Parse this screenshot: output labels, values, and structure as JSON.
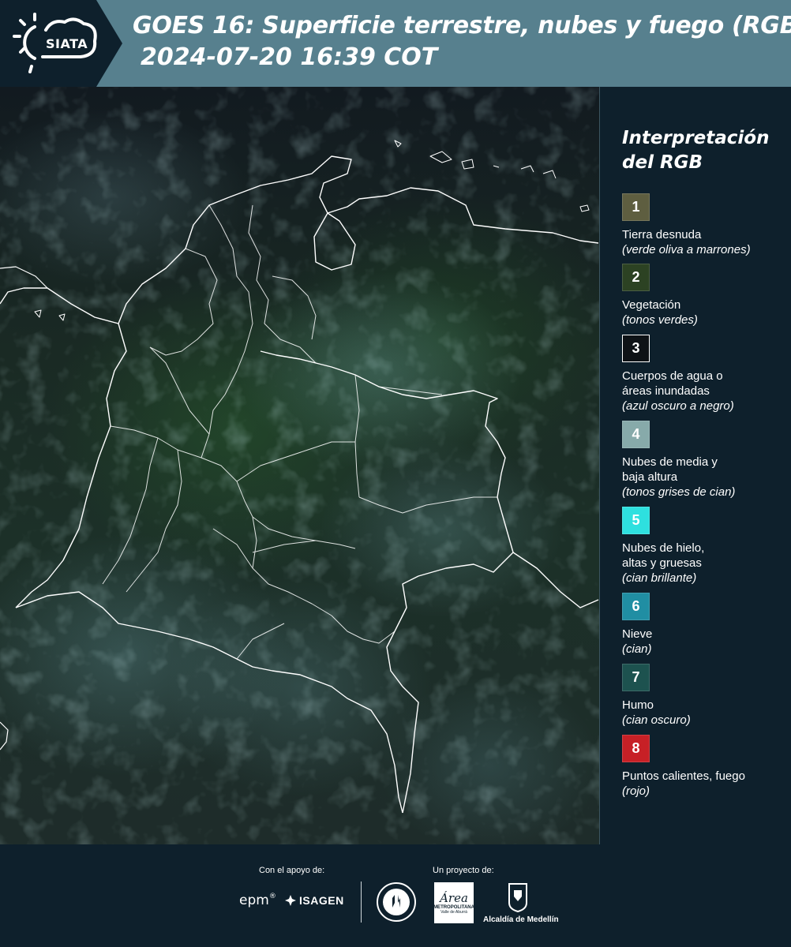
{
  "header": {
    "logo_text": "SIATA",
    "title": "GOES 16: Superficie terrestre, nubes y fuego (RGB)",
    "datetime": "2024-07-20 16:39 COT"
  },
  "legend": {
    "title_line1": "Interpretación",
    "title_line2": "del RGB",
    "items": [
      {
        "number": "1",
        "color": "#5e5e40",
        "label_lines": [
          "Tierra desnuda"
        ],
        "desc": "(verde oliva a marrones)"
      },
      {
        "number": "2",
        "color": "#2c4223",
        "label_lines": [
          "Vegetación"
        ],
        "desc": "(tonos verdes)"
      },
      {
        "number": "3",
        "color": "#0e1216",
        "label_lines": [
          "Cuerpos de agua o",
          "áreas inundadas"
        ],
        "desc": "(azul oscuro a negro)"
      },
      {
        "number": "4",
        "color": "#87aaaa",
        "label_lines": [
          "Nubes de media y",
          "baja altura"
        ],
        "desc": "(tonos grises de cian)"
      },
      {
        "number": "5",
        "color": "#2ee0df",
        "label_lines": [
          "Nubes de hielo,",
          "altas y gruesas"
        ],
        "desc": "(cian brillante)"
      },
      {
        "number": "6",
        "color": "#208ea3",
        "label_lines": [
          "Nieve"
        ],
        "desc": "(cian)"
      },
      {
        "number": "7",
        "color": "#1d524f",
        "label_lines": [
          "Humo"
        ],
        "desc": "(cian oscuro)"
      },
      {
        "number": "8",
        "color": "#c72026",
        "label_lines": [
          "Puntos calientes, fuego"
        ],
        "desc": "(rojo)"
      }
    ]
  },
  "footer": {
    "support_label": "Con el apoyo de:",
    "project_label": "Un proyecto de:",
    "epm": "epm",
    "isagen": "ISAGEN",
    "metropolitana": "METROPOLITANA",
    "metropolitana_sub": "Valle de Aburrá",
    "area": "Área",
    "alcaldia": "Alcaldía de Medellín"
  }
}
